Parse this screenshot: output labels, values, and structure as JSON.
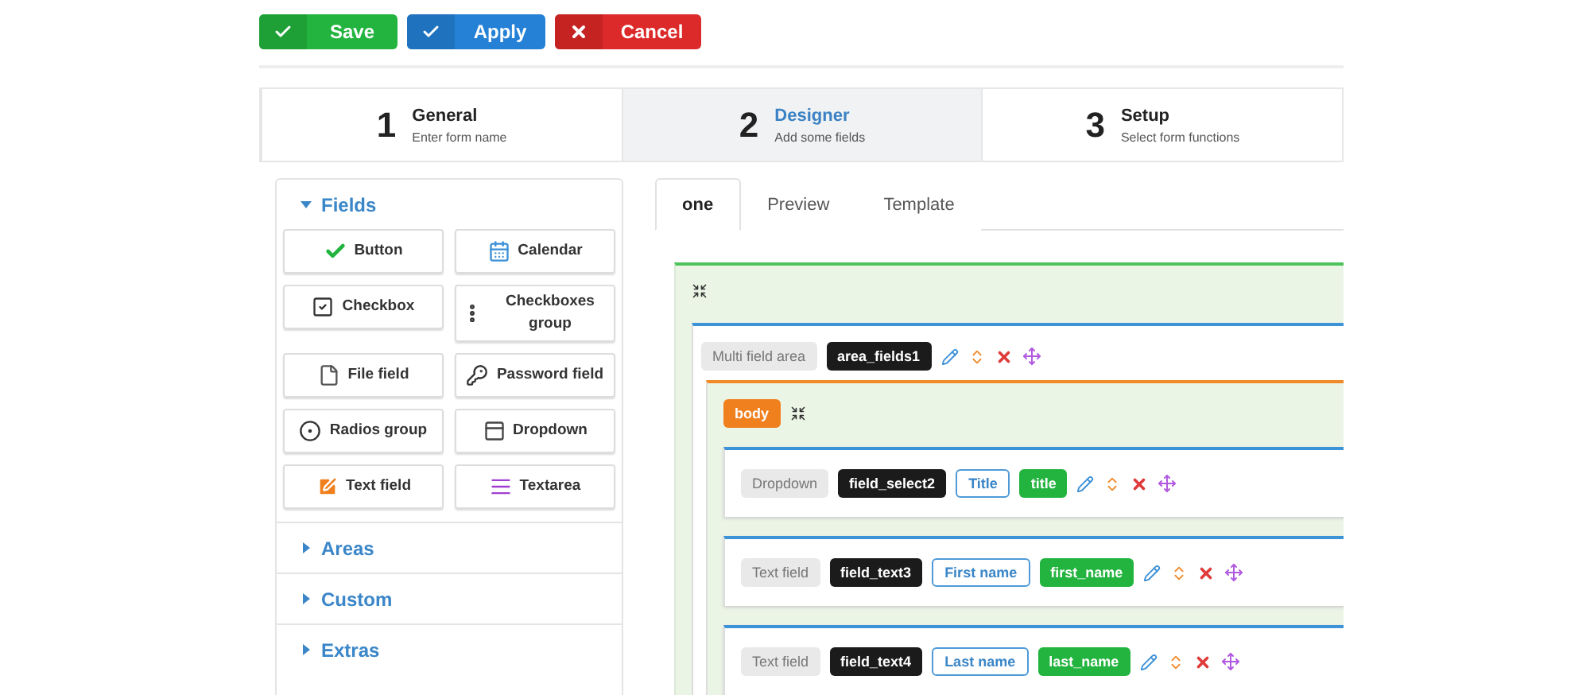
{
  "toolbar": [
    {
      "label": "Save",
      "kind": "save"
    },
    {
      "label": "Apply",
      "kind": "apply"
    },
    {
      "label": "Cancel",
      "kind": "cancel"
    }
  ],
  "steps": [
    {
      "number": "1",
      "title": "General",
      "subtitle": "Enter form name",
      "selected": false
    },
    {
      "number": "2",
      "title": "Designer",
      "subtitle": "Add some fields",
      "selected": true
    },
    {
      "number": "3",
      "title": "Setup",
      "subtitle": "Select form functions",
      "selected": false
    }
  ],
  "sections": [
    {
      "title": "Fields",
      "expanded": true,
      "items": [
        {
          "label": "Button",
          "kind": "button"
        },
        {
          "label": "Calendar",
          "kind": "calendar"
        },
        {
          "label": "Checkbox",
          "kind": "checkbox"
        },
        {
          "label": "Checkboxes group",
          "kind": "checkboxes"
        },
        {
          "label": "File field",
          "kind": "file"
        },
        {
          "label": "Password field",
          "kind": "password"
        },
        {
          "label": "Radios group",
          "kind": "radios"
        },
        {
          "label": "Dropdown",
          "kind": "dropdown"
        },
        {
          "label": "Text field",
          "kind": "text"
        },
        {
          "label": "Textarea",
          "kind": "textarea"
        }
      ]
    },
    {
      "title": "Areas",
      "expanded": false
    },
    {
      "title": "Custom",
      "expanded": false
    },
    {
      "title": "Extras",
      "expanded": false
    }
  ],
  "tabs": [
    {
      "label": "one",
      "selected": true
    },
    {
      "label": "Preview",
      "selected": false
    },
    {
      "label": "Template",
      "selected": false
    }
  ],
  "area": {
    "type": "Multi field area",
    "name": "area_fields1",
    "section": "body",
    "fields": [
      {
        "type": "Dropdown",
        "name": "field_select2",
        "label": "Title",
        "var": "title"
      },
      {
        "type": "Text field",
        "name": "field_text3",
        "label": "First name",
        "var": "first_name"
      },
      {
        "type": "Text field",
        "name": "field_text4",
        "label": "Last name",
        "var": "last_name"
      }
    ]
  }
}
